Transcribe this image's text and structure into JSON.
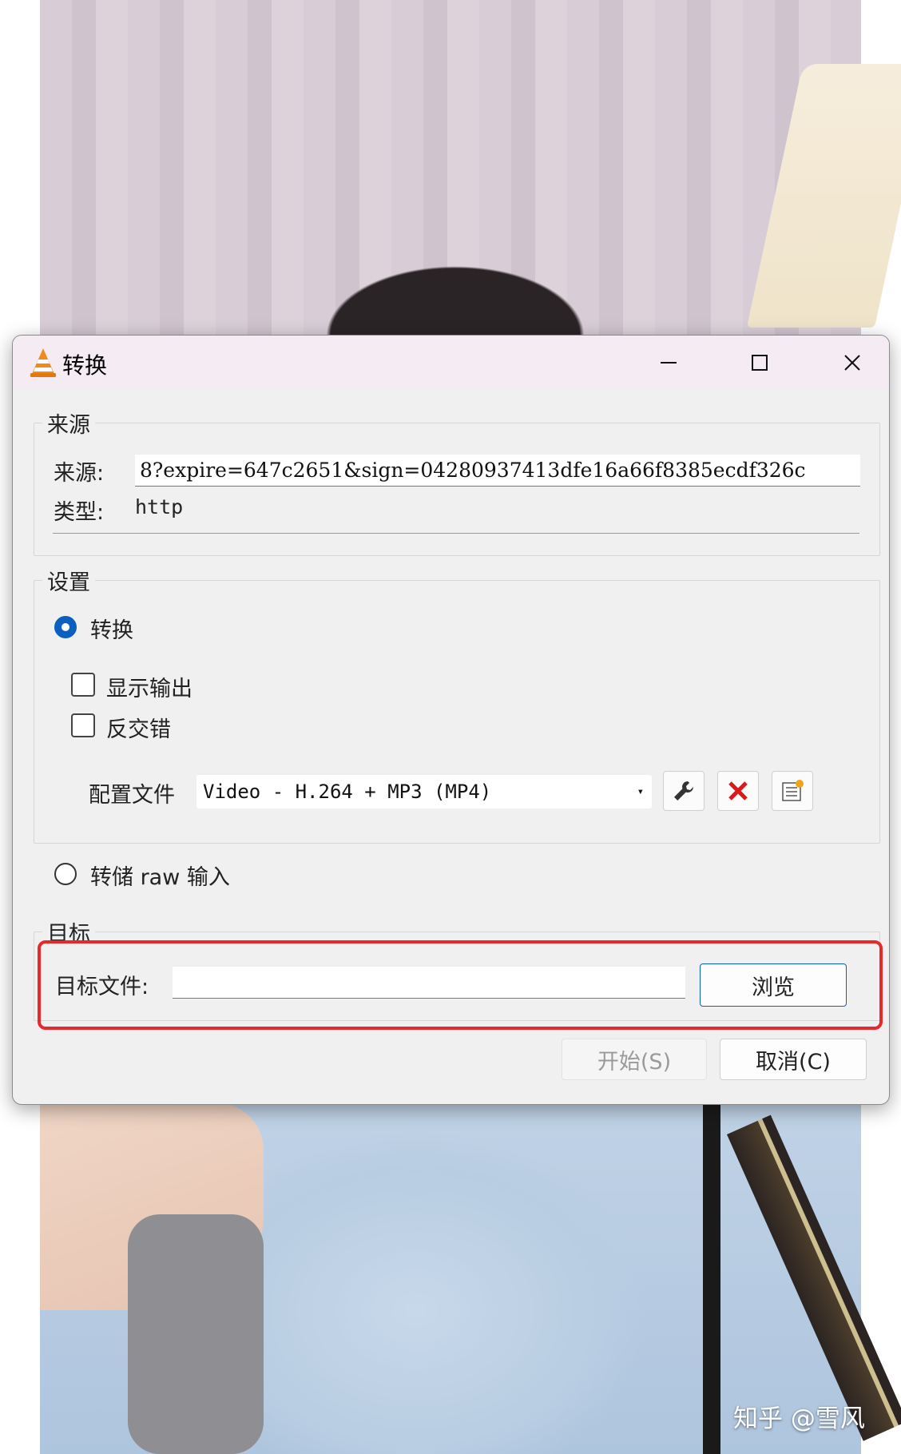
{
  "window": {
    "title": "转换"
  },
  "source_group": {
    "legend": "来源",
    "source_label": "来源:",
    "source_value": "8?expire=647c2651&sign=04280937413dfe16a66f8385ecdf326c",
    "type_label": "类型:",
    "type_value": "http"
  },
  "settings_group": {
    "legend": "设置",
    "convert_label": "转换",
    "convert_selected": true,
    "show_output_label": "显示输出",
    "deinterlace_label": "反交错",
    "profile_label": "配置文件",
    "profile_value": "Video - H.264 + MP3 (MP4)",
    "dump_raw_label": "转储 raw 输入",
    "dump_raw_selected": false
  },
  "destination_group": {
    "legend": "目标",
    "dest_file_label": "目标文件:",
    "dest_file_value": "",
    "browse_label": "浏览"
  },
  "buttons": {
    "start_label": "开始(S)",
    "cancel_label": "取消(C)"
  },
  "watermark": "知乎 @雪风",
  "colors": {
    "accent": "#0a5fbf",
    "highlight_box": "#e8282a",
    "delete_icon": "#d9191c"
  }
}
